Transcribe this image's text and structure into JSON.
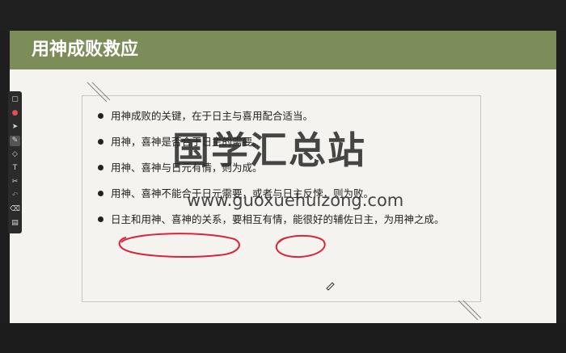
{
  "slide": {
    "title": "用神成败救应",
    "bullets": [
      "用神成败的关键，在于日主与喜用配合适当。",
      "用神，喜神是否合于日主的需要。",
      "用神、喜神与日元有情，则为成。",
      "用神、喜神不能合于日元需要，或者与日主反悖，则为败。",
      "日主和用神、喜神的关系，要相互有情，能很好的辅佐日主，为用神之成。"
    ]
  },
  "watermark": {
    "chinese": "国学汇总站",
    "url": "www.guoxuehuizong.com"
  },
  "colors": {
    "title_bar": "#7d8d5a",
    "slide_bg": "#f4f3ef",
    "ink_red": "#d8243b",
    "toolbar_bg": "#2b2b2b"
  },
  "toolbar": {
    "tools": [
      "file-icon",
      "laser-pointer-icon",
      "cursor-icon",
      "pen-icon",
      "shapes-icon",
      "text-icon",
      "scissors-icon",
      "undo-icon",
      "eraser-icon",
      "save-icon"
    ]
  }
}
